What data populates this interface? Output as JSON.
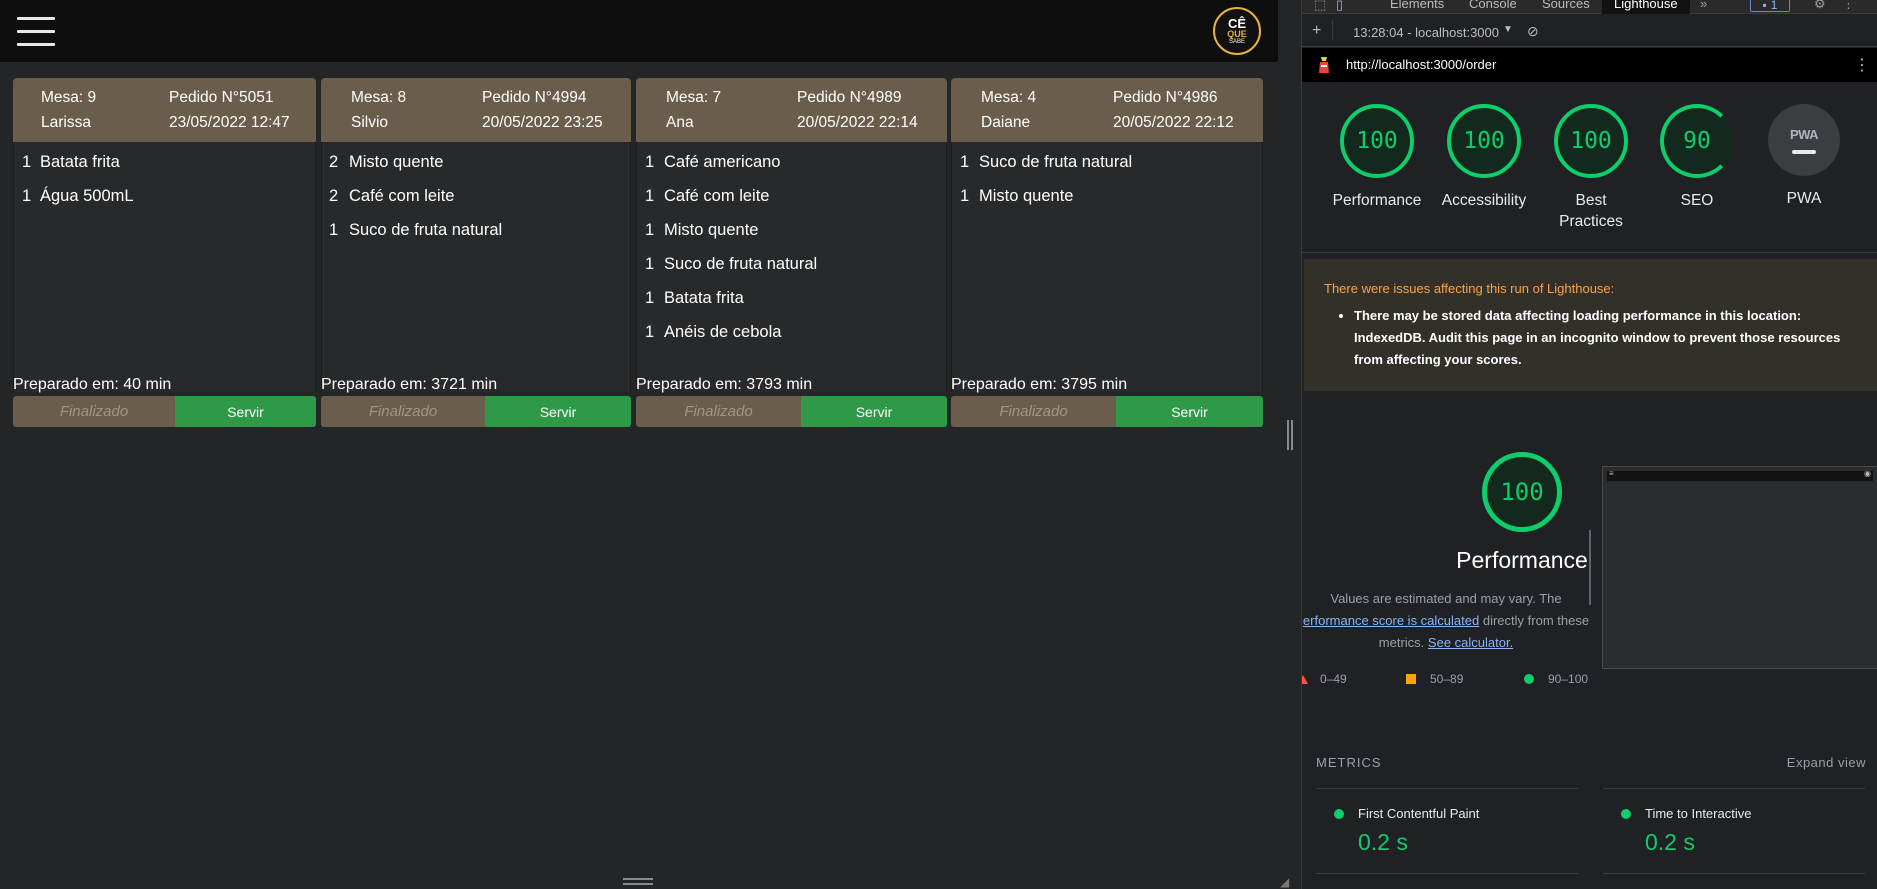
{
  "app": {
    "logo": {
      "line1": "CÊ",
      "line2": "QUE",
      "line3": "SABE"
    },
    "orders": [
      {
        "mesa": "Mesa: 9",
        "pedido": "Pedido N°5051",
        "name": "Larissa",
        "datetime": "23/05/2022 12:47",
        "items": [
          {
            "qty": "1",
            "name": "Batata frita"
          },
          {
            "qty": "1",
            "name": "Água 500mL"
          }
        ],
        "prep": "Preparado em: 40 min",
        "finalizado_label": "Finalizado",
        "servir_label": "Servir"
      },
      {
        "mesa": "Mesa: 8",
        "pedido": "Pedido N°4994",
        "name": "Silvio",
        "datetime": "20/05/2022 23:25",
        "items": [
          {
            "qty": "2",
            "name": "Misto quente"
          },
          {
            "qty": "2",
            "name": "Café com leite"
          },
          {
            "qty": "1",
            "name": "Suco de fruta natural"
          }
        ],
        "prep": "Preparado em: 3721 min",
        "finalizado_label": "Finalizado",
        "servir_label": "Servir"
      },
      {
        "mesa": "Mesa: 7",
        "pedido": "Pedido N°4989",
        "name": "Ana",
        "datetime": "20/05/2022 22:14",
        "items": [
          {
            "qty": "1",
            "name": "Café americano"
          },
          {
            "qty": "1",
            "name": "Café com leite"
          },
          {
            "qty": "1",
            "name": "Misto quente"
          },
          {
            "qty": "1",
            "name": "Suco de fruta natural"
          },
          {
            "qty": "1",
            "name": "Batata frita"
          },
          {
            "qty": "1",
            "name": "Anéis de cebola"
          }
        ],
        "prep": "Preparado em: 3793 min",
        "finalizado_label": "Finalizado",
        "servir_label": "Servir"
      },
      {
        "mesa": "Mesa: 4",
        "pedido": "Pedido N°4986",
        "name": "Daiane",
        "datetime": "20/05/2022 22:12",
        "items": [
          {
            "qty": "1",
            "name": "Suco de fruta natural"
          },
          {
            "qty": "1",
            "name": "Misto quente"
          }
        ],
        "prep": "Preparado em: 3795 min",
        "finalizado_label": "Finalizado",
        "servir_label": "Servir"
      }
    ]
  },
  "devtools": {
    "tabs": [
      "Elements",
      "Console",
      "Sources",
      "Lighthouse"
    ],
    "active_tab": "Lighthouse",
    "more_tabs": "»",
    "issues_count": "1",
    "report_selector": "13:28:04 - localhost:3000",
    "url": "http://localhost:3000/order",
    "scores": [
      {
        "label": "Performance",
        "value": "100"
      },
      {
        "label": "Accessibility",
        "value": "100"
      },
      {
        "label": "Best Practices",
        "value": "100"
      },
      {
        "label": "SEO",
        "value": "90"
      },
      {
        "label": "PWA",
        "value": ""
      }
    ],
    "pwa_badge": "PWA",
    "warning": {
      "title": "There were issues affecting this run of Lighthouse:",
      "item": "There may be stored data affecting loading performance in this location: IndexedDB. Audit this page in an incognito window to prevent those resources from affecting your scores."
    },
    "performance": {
      "score": "100",
      "title": "Performance",
      "desc_prefix": "Values are estimated and may vary. The",
      "desc_link": "erformance score is calculated",
      "desc_mid": "directly from these metrics.",
      "desc_link2": "See calculator."
    },
    "legend": {
      "low": "0–49",
      "mid": "50–89",
      "high": "90–100"
    },
    "colors": {
      "pass": "#0cce6b",
      "average": "#ffa400",
      "fail": "#ff4e42"
    },
    "metrics_header": "METRICS",
    "expand_view": "Expand view",
    "metrics": [
      {
        "name": "First Contentful Paint",
        "value": "0.2 s"
      },
      {
        "name": "Time to Interactive",
        "value": "0.2 s"
      }
    ]
  }
}
